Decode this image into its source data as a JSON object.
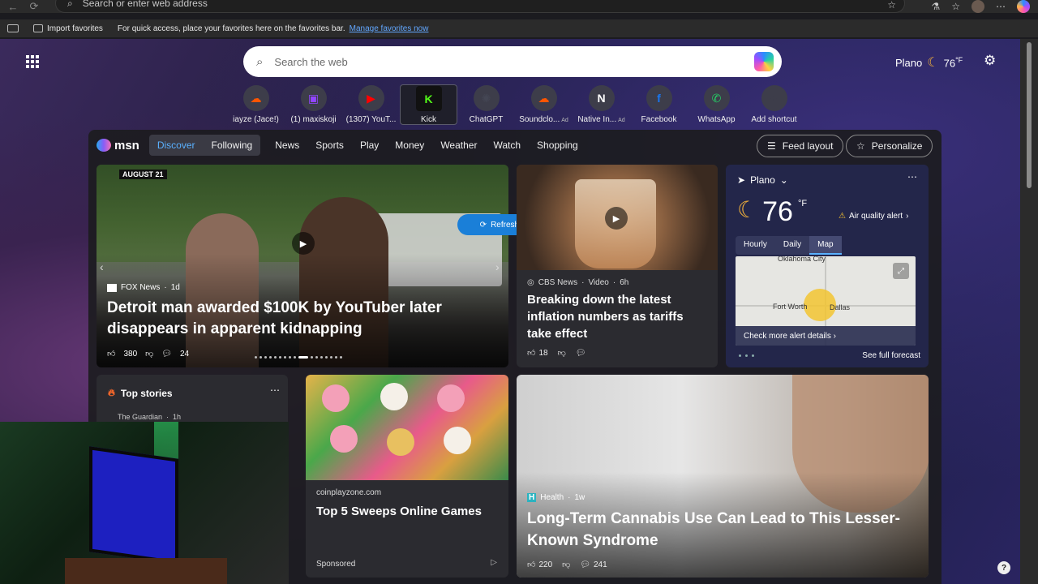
{
  "browser": {
    "address_placeholder": "Search or enter web address",
    "favbar": {
      "import_label": "Import favorites",
      "message": "For quick access, place your favorites here on the favorites bar.",
      "manage_link": "Manage favorites now"
    }
  },
  "newtab": {
    "search_placeholder": "Search the web",
    "weather": {
      "city": "Plano",
      "temp": "76",
      "unit": "°F"
    },
    "shortcuts": [
      {
        "label": "iayze (Jace!)",
        "icon": "soundcloud-icon",
        "color": "#ff5500",
        "glyph": "☁",
        "ad": ""
      },
      {
        "label": "(1) maxiskoji",
        "icon": "twitch-icon",
        "color": "#9146ff",
        "glyph": "▣",
        "ad": ""
      },
      {
        "label": "(1307) YouT...",
        "icon": "youtube-icon",
        "color": "#ff0000",
        "glyph": "▶",
        "ad": ""
      },
      {
        "label": "Kick",
        "icon": "kick-icon",
        "color": "#53fc18",
        "glyph": "K",
        "ad": ""
      },
      {
        "label": "ChatGPT",
        "icon": "chatgpt-icon",
        "color": "#444654",
        "glyph": "✺",
        "ad": ""
      },
      {
        "label": "Soundclo...",
        "icon": "soundcloud-icon",
        "color": "#ff5500",
        "glyph": "☁",
        "ad": "Ad"
      },
      {
        "label": "Native In...",
        "icon": "native-instruments-icon",
        "color": "#ffffff",
        "glyph": "N",
        "ad": "Ad"
      },
      {
        "label": "Facebook",
        "icon": "facebook-icon",
        "color": "#1877f2",
        "glyph": "f",
        "ad": ""
      },
      {
        "label": "WhatsApp",
        "icon": "whatsapp-icon",
        "color": "#25d366",
        "glyph": "✆",
        "ad": ""
      },
      {
        "label": "Add shortcut",
        "icon": "plus-icon",
        "color": "#3d3d4a",
        "glyph": "+",
        "ad": ""
      }
    ]
  },
  "msn": {
    "logo": "msn",
    "tabs": [
      "Discover",
      "Following"
    ],
    "nav": [
      "News",
      "Sports",
      "Play",
      "Money",
      "Weather",
      "Watch",
      "Shopping"
    ],
    "feed_layout": "Feed layout",
    "personalize": "Personalize",
    "refresh": "Refresh stories",
    "hero": {
      "date_badge": "AUGUST 21",
      "source": "FOX News",
      "age": "1d",
      "title": "Detroit man awarded $100K by YouTuber later disappears in apparent kidnapping",
      "likes": "380",
      "comments": "24"
    },
    "card2": {
      "source": "CBS News",
      "kind": "Video",
      "age": "6h",
      "title": "Breaking down the latest inflation numbers as tariffs take effect",
      "likes": "18"
    },
    "weather_card": {
      "city": "Plano",
      "temp": "76",
      "unit": "°F",
      "alert": "Air quality alert",
      "tabs": [
        "Hourly",
        "Daily",
        "Map"
      ],
      "map_labels": {
        "north": "Oklahoma City",
        "fw": "Fort Worth",
        "dallas": "Dallas"
      },
      "alert_cta": "Check more alert details",
      "forecast_link": "See full forecast"
    },
    "top_stories": {
      "title": "Top stories",
      "first_source": "The Guardian",
      "first_age": "1h"
    },
    "card3": {
      "source": "coinplayzone.com",
      "title": "Top 5 Sweeps Online Games",
      "sponsored": "Sponsored"
    },
    "card4": {
      "source": "Health",
      "age": "1w",
      "title": "Long-Term Cannabis Use Can Lead to This Lesser-Known Syndrome",
      "likes": "220",
      "comments": "241"
    }
  }
}
